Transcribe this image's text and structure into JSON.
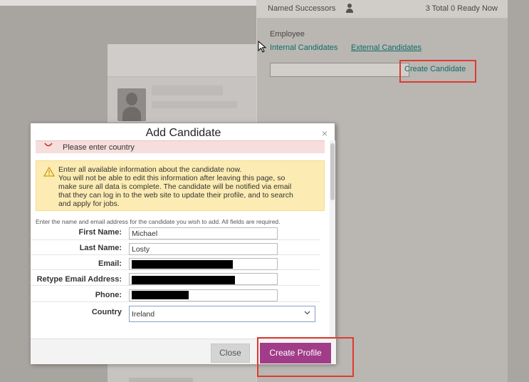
{
  "right_panel": {
    "named_successors_label": "Named Successors",
    "counts_text": "3 Total 0 Ready Now",
    "employee_label": "Employee",
    "internal_link": "Internal Candidates",
    "external_link": "External Candidates",
    "create_candidate_link": "Create Candidate"
  },
  "modal": {
    "title": "Add Candidate",
    "close_glyph": "×",
    "error_message": "Please enter country",
    "warning_lines": [
      "Enter all available information about the candidate now.",
      "You will not be able to edit this information after leaving this page, so",
      "make sure all data is complete. The candidate will be notified via email",
      "that they can log in to the web site to update their profile, and to search",
      "and apply for jobs."
    ],
    "instructions": "Enter the name and email address for the candidate you wish to add. All fields are required.",
    "fields": {
      "first_name": {
        "label": "First Name:",
        "value": "Michael"
      },
      "last_name": {
        "label": "Last Name:",
        "value": "Losty"
      },
      "email": {
        "label": "Email:",
        "value": ""
      },
      "retype_email": {
        "label": "Retype Email Address:",
        "value": ""
      },
      "phone": {
        "label": "Phone:",
        "value": ""
      },
      "country": {
        "label": "Country",
        "value": "Ireland"
      }
    },
    "buttons": {
      "close": "Close",
      "create_profile": "Create Profile"
    }
  },
  "colors": {
    "accent_teal": "#0f6d6a",
    "primary_button": "#a13d88",
    "highlight_red": "#e03a2f",
    "warning_bg": "#fcecb3",
    "error_bg": "#f6dedd"
  }
}
